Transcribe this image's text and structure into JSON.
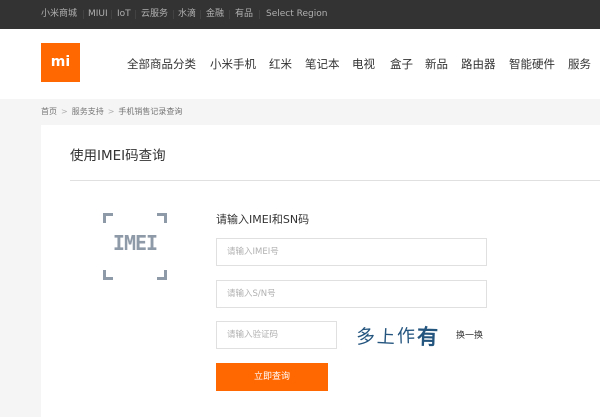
{
  "topbar": {
    "links": [
      "小米商城",
      "MIUI",
      "IoT",
      "云服务",
      "水滴",
      "金融",
      "有品",
      "Select Region"
    ]
  },
  "header": {
    "logo_text": "mi",
    "nav": [
      "全部商品分类",
      "小米手机",
      "红米",
      "笔记本",
      "电视",
      "盒子",
      "新品",
      "路由器",
      "智能硬件",
      "服务"
    ]
  },
  "breadcrumb": {
    "items": [
      "首页",
      "服务支持",
      "手机销售记录查询"
    ],
    "separator": ">"
  },
  "panel": {
    "title": "使用IMEI码查询"
  },
  "form": {
    "badge_text": "IMEI",
    "heading": "请输入IMEI和SN码",
    "imei_placeholder": "请输入IMEI号",
    "sn_placeholder": "请输入S/N号",
    "captcha_placeholder": "请输入验证码",
    "captcha_chars": [
      "多",
      "上",
      "作",
      "有"
    ],
    "refresh_label": "换一换",
    "submit_label": "立即查询"
  },
  "colors": {
    "brand_orange": "#ff6700",
    "topbar_bg": "#333333",
    "captcha_blue": "#24557f",
    "icon_gray": "#8f9aa8"
  }
}
